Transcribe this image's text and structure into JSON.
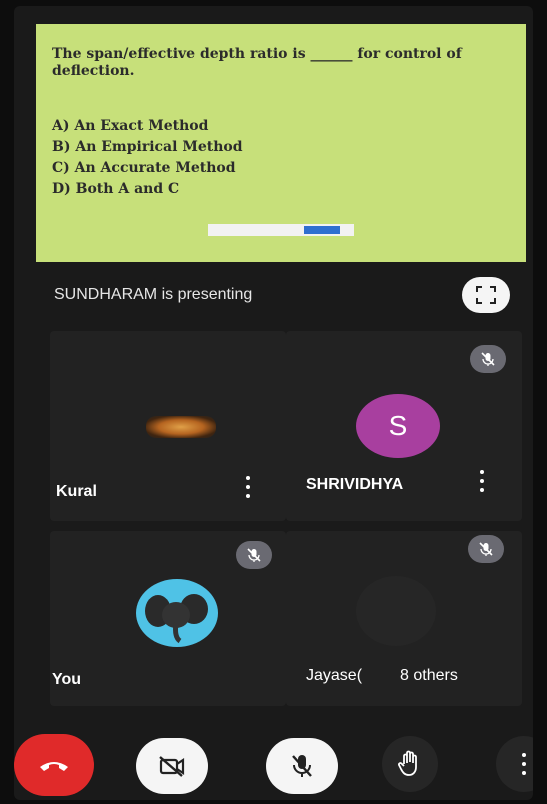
{
  "slide": {
    "question": "The span/effective depth ratio is ______ for control of deflection.",
    "options": [
      "A) An Exact Method",
      "B) An Empirical Method",
      "C) An Accurate Method",
      "D) Both A and C"
    ],
    "background_color": "#c7e07a"
  },
  "presenter": {
    "text": "SUNDHARAM is presenting"
  },
  "participants": [
    {
      "name": "Kural",
      "muted": false,
      "video": "blurred"
    },
    {
      "name": "SHRIVIDHYA",
      "muted": true,
      "avatar_letter": "S",
      "avatar_color": "#a83f9f"
    },
    {
      "name": "You",
      "muted": true,
      "avatar_color": "#4fc2e6"
    },
    {
      "name": "Jayase(",
      "extra": "8 others",
      "muted": true
    }
  ],
  "controls": {
    "end_call_color": "#e02a2a",
    "icons": [
      "end-call-icon",
      "camera-off-icon",
      "mic-off-icon",
      "raise-hand-icon",
      "more-options-icon"
    ]
  }
}
